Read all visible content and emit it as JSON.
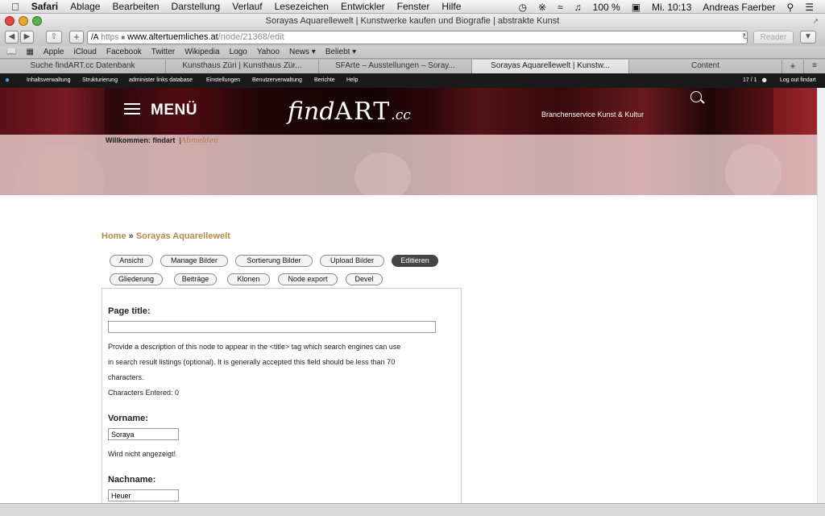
{
  "os_menubar": {
    "apple": "",
    "app": "Safari",
    "items": [
      "Ablage",
      "Bearbeiten",
      "Darstellung",
      "Verlauf",
      "Lesezeichen",
      "Entwickler",
      "Fenster",
      "Hilfe"
    ],
    "battery": "100 %",
    "clock": "Mi. 10:13",
    "user": "Andreas Faerber"
  },
  "window": {
    "title": "Sorayas Aquarellewelt | Kunstwerke kaufen und Biografie | abstrakte Kunst"
  },
  "toolbar": {
    "url_protocol": "https",
    "url_host": "www.altertuemliches.at",
    "url_path": "/node/21368/edit",
    "reader_label": "Reader"
  },
  "bookmarks": [
    "Apple",
    "iCloud",
    "Facebook",
    "Twitter",
    "Wikipedia",
    "Logo",
    "Yahoo",
    "News ▾",
    "Beliebt ▾"
  ],
  "tabs": [
    {
      "label": "Suche findART.cc Datenbank"
    },
    {
      "label": "Kunsthaus Züri | Kunsthaus Zür..."
    },
    {
      "label": "SFArte – Ausstellungen – Soray..."
    },
    {
      "label": "Sorayas Aquarellewelt | Kunstw..."
    },
    {
      "label": "Content"
    }
  ],
  "adminbar": {
    "items": [
      "Inhaltsverwaltung",
      "Strukturierung",
      "administer links database",
      "Einstellungen",
      "Benutzerverwaltung",
      "Berichte",
      "Help"
    ],
    "counter": "17 / 1",
    "logout": "Log out findart"
  },
  "header": {
    "menu_label": "MENÜ",
    "logo_find": "find",
    "logo_art": "ART",
    "logo_cc": ".cc",
    "slogan": "Branchenservice Kunst & Kultur",
    "welcome_label": "Willkommen: findart",
    "welcome_sep": "|",
    "logout_link": "Abmelden"
  },
  "breadcrumb": {
    "home": "Home",
    "sep": "»",
    "current": "Sorayas Aquarellewelt"
  },
  "node_tabs_row1": [
    "Ansicht",
    "Manage Bilder",
    "Sortierung Bilder",
    "Upload Bilder",
    "Editieren"
  ],
  "node_tabs_row2": [
    "Gliederung",
    "Beiträge",
    "Klonen",
    "Node export",
    "Devel"
  ],
  "form": {
    "page_title_label": "Page title:",
    "page_title_value": "",
    "page_title_help_1": "Provide a description of this node to appear in the <title> tag which search engines can use",
    "page_title_help_2": "in search result listings (optional). It is generally accepted this field should be less than 70",
    "page_title_help_3": "characters.",
    "chars_entered": "Characters Entered: 0",
    "vorname_label": "Vorname:",
    "vorname_value": "Soraya",
    "vorname_help": "Wird nicht angezeigt!",
    "nachname_label": "Nachname:",
    "nachname_value": "Heuer"
  }
}
